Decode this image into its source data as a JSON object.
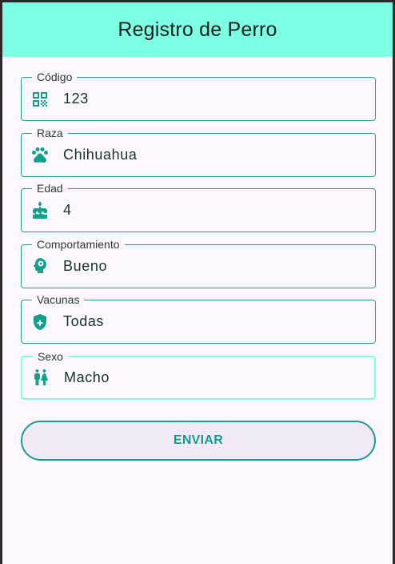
{
  "app_bar": {
    "title": "Registro de Perro"
  },
  "fields": [
    {
      "label": "Código",
      "value": "123",
      "icon": "qr-code-icon"
    },
    {
      "label": "Raza",
      "value": "Chihuahua",
      "icon": "paw-icon"
    },
    {
      "label": "Edad",
      "value": "4",
      "icon": "cake-icon"
    },
    {
      "label": "Comportamiento",
      "value": "Bueno",
      "icon": "psychology-head-icon"
    },
    {
      "label": "Vacunas",
      "value": "Todas",
      "icon": "health-shield-icon"
    },
    {
      "label": "Sexo",
      "value": "Macho",
      "icon": "wc-icon",
      "focused": true
    }
  ],
  "submit_label": "ENVIAR",
  "colors": {
    "app_bar": "#7dffe3",
    "accent": "#12a08c",
    "background": "#fcf6fd"
  }
}
